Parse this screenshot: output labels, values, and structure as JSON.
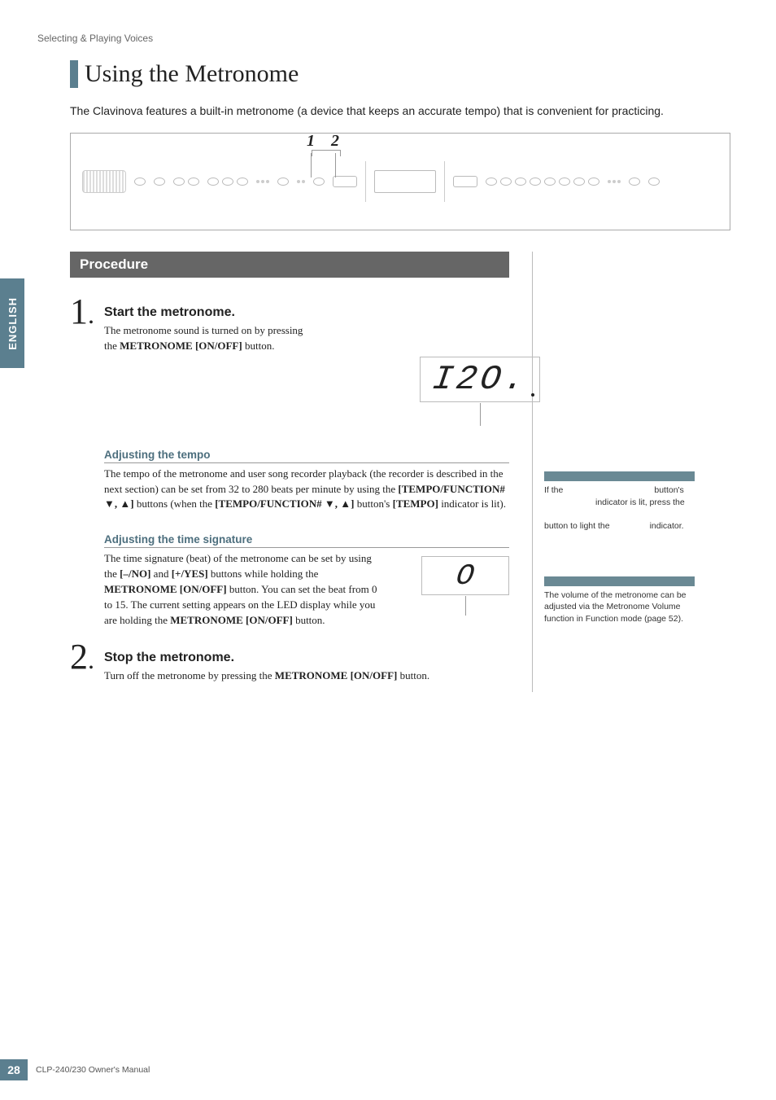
{
  "runningHead": "Selecting & Playing Voices",
  "sidetab": "ENGLISH",
  "title": "Using the Metronome",
  "intro": "The Clavinova features a built-in metronome (a device that keeps an accurate tempo) that is convenient for practicing.",
  "diagram": {
    "label1": "1",
    "label2": "2"
  },
  "procedureHeading": "Procedure",
  "step1": {
    "num": "1",
    "dot": ".",
    "head": "Start the metronome.",
    "line1": "The metronome sound is turned on by pressing",
    "line2a": "the ",
    "line2b": "METRONOME [ON/OFF]",
    "line2c": " button.",
    "display": "I2O.",
    "tempoHead": "Adjusting the tempo",
    "tempoP1": "The tempo of the metronome and user song recorder playback (the recorder is described in the next section) can be set from 32 to 280 beats per minute by using the ",
    "tempoB1": "[TEMPO/FUNCTION# ▼, ▲]",
    "tempoP2": " buttons (when the ",
    "tempoB2": "[TEMPO/FUNCTION# ▼, ▲]",
    "tempoP3": " button's ",
    "tempoB3": "[TEMPO]",
    "tempoP4": " indicator is lit).",
    "sigHead": "Adjusting the time signature",
    "sigP1": "The time signature (beat) of the metronome can be set by using the ",
    "sigB1": "[–/NO]",
    "sigP2": " and ",
    "sigB2": "[+/YES]",
    "sigP3": " buttons while holding the ",
    "sigB3": "METRONOME [ON/OFF]",
    "sigP4": " button. You can set the beat from 0 to 15. The current setting appears on the LED display while you are holding the ",
    "sigB4": "METRONOME [ON/OFF]",
    "sigP5": " button.",
    "sigDisplay": "O"
  },
  "step2": {
    "num": "2",
    "dot": ".",
    "head": "Stop the metronome.",
    "p1": "Turn off the metronome by pressing the ",
    "b1": "METRONOME [ON/OFF]",
    "p2": " button."
  },
  "tip1": {
    "l1": "If the ",
    "l2": " button's ",
    "l3": " indicator is lit, press the ",
    "l4": " button to light the ",
    "l5": " indicator."
  },
  "tip2": {
    "text": "The volume of the metronome can be adjusted via the Metronome Volume function in Function mode (page 52)."
  },
  "footer": {
    "page": "28",
    "text": "CLP-240/230 Owner's Manual"
  }
}
